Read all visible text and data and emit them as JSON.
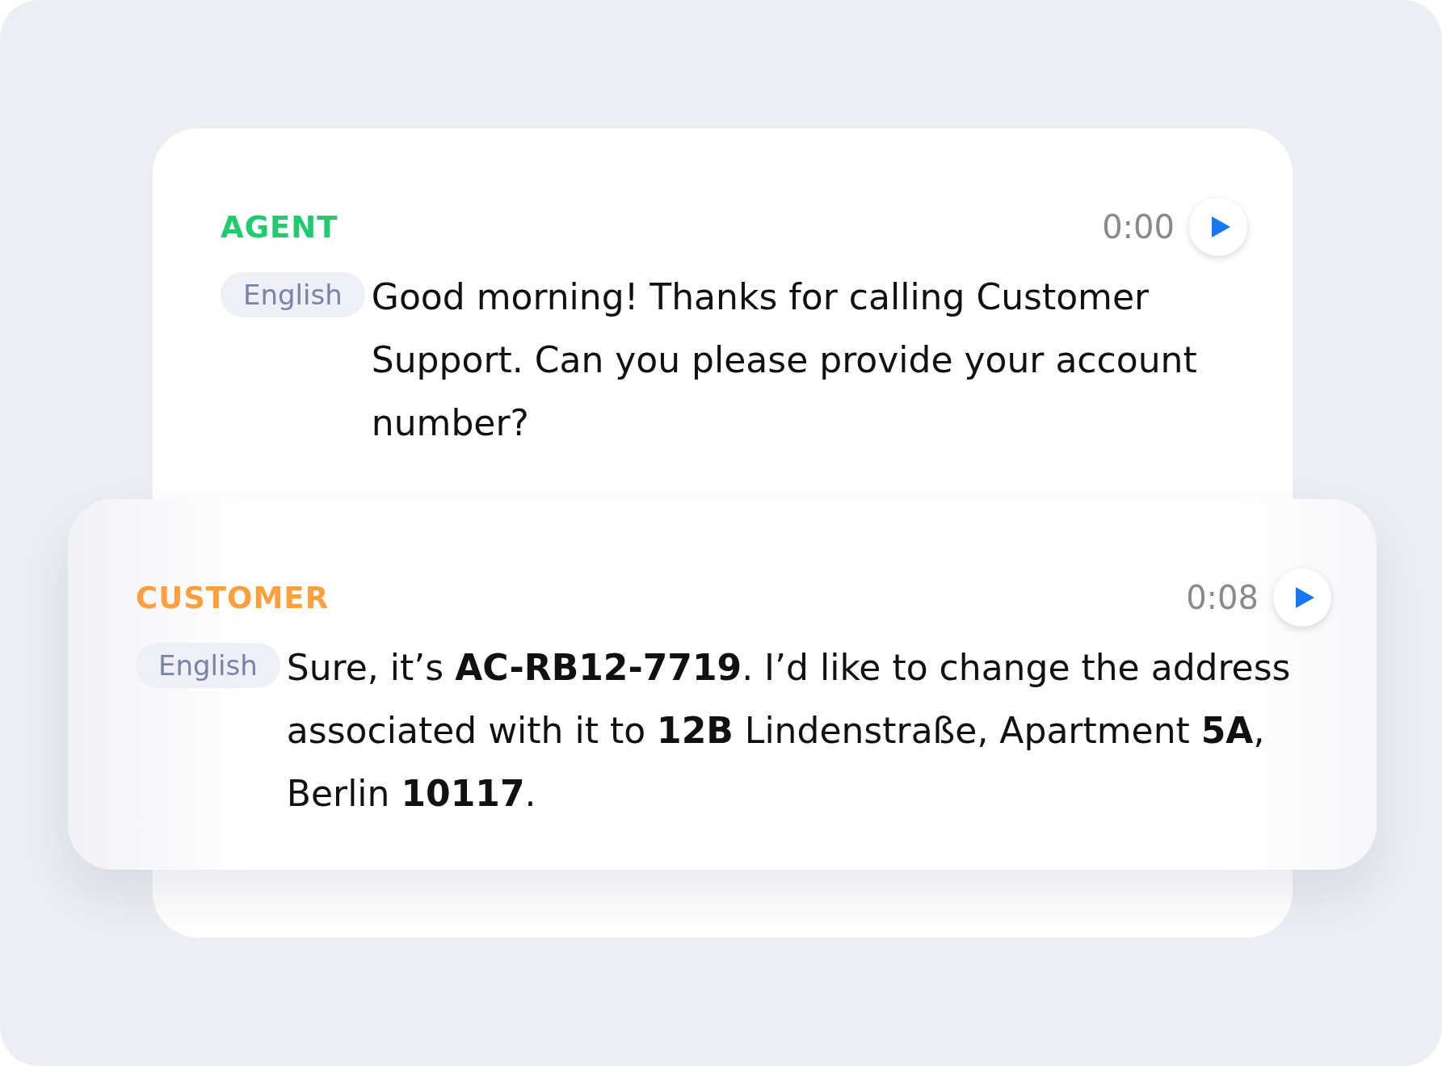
{
  "messages": [
    {
      "kind": "agent",
      "speaker": "AGENT",
      "color": "#1fcb6e",
      "time": "0:00",
      "language": "English",
      "text": "Good morning! Thanks for calling Customer Support. Can you please provide your account number?"
    },
    {
      "kind": "customer",
      "speaker": "CUSTOMER",
      "color": "#ff9f3d",
      "time": "0:08",
      "language": "English",
      "text": "Sure, it’s **AC-RB12-7719**. I’d like to change the address associated with it to **12B** Lindenstraße, Apartment **5A**, Berlin **10117**."
    }
  ]
}
